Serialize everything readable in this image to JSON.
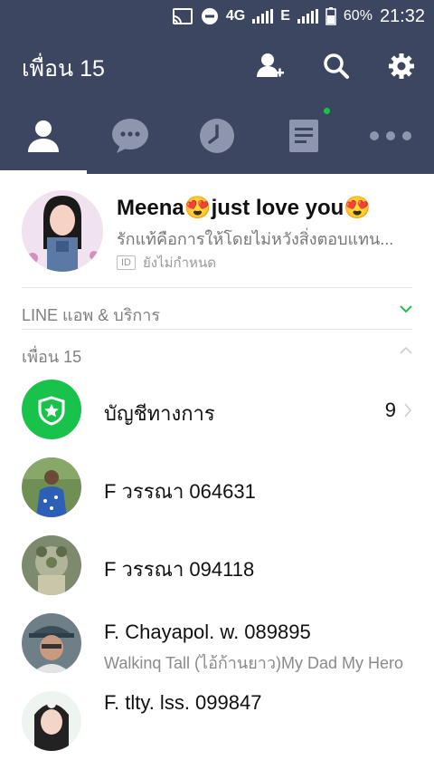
{
  "status_bar": {
    "network": "4G",
    "network2": "E",
    "battery": "60%",
    "time": "21:32"
  },
  "header": {
    "title": "เพื่อน 15"
  },
  "tabs": [
    {
      "name": "friends",
      "active": true
    },
    {
      "name": "chats"
    },
    {
      "name": "timeline"
    },
    {
      "name": "news",
      "badge": true
    },
    {
      "name": "more"
    }
  ],
  "profile": {
    "name": "Meena😍just love you😍",
    "status": "รักแท้คือการให้โดยไม่หวังสิ่งตอบแทน...",
    "id_badge": "ID",
    "id_value": "ยังไม่กำหนด"
  },
  "sections": {
    "services": "LINE แอพ & บริการ",
    "friends": "เพื่อน 15"
  },
  "friends": [
    {
      "name": "บัญชีทางการ",
      "count": "9",
      "avatar": "official-shield"
    },
    {
      "name": "F วรรณา 064631",
      "sub": "",
      "avatar": "photo"
    },
    {
      "name": "F วรรณา 094118",
      "sub": "",
      "avatar": "photo"
    },
    {
      "name": "F. Chayapol. w. 089895",
      "sub": "Walkinq  Tall  (ไอ้ก้านยาว)My Dad My Hero",
      "avatar": "photo"
    },
    {
      "name": "F. tlty. lss. 099847",
      "sub": "",
      "avatar": "photo"
    }
  ],
  "colors": {
    "header_bg": "#3d4660",
    "accent_green": "#19c34b",
    "tab_inactive": "#8e96ad"
  }
}
